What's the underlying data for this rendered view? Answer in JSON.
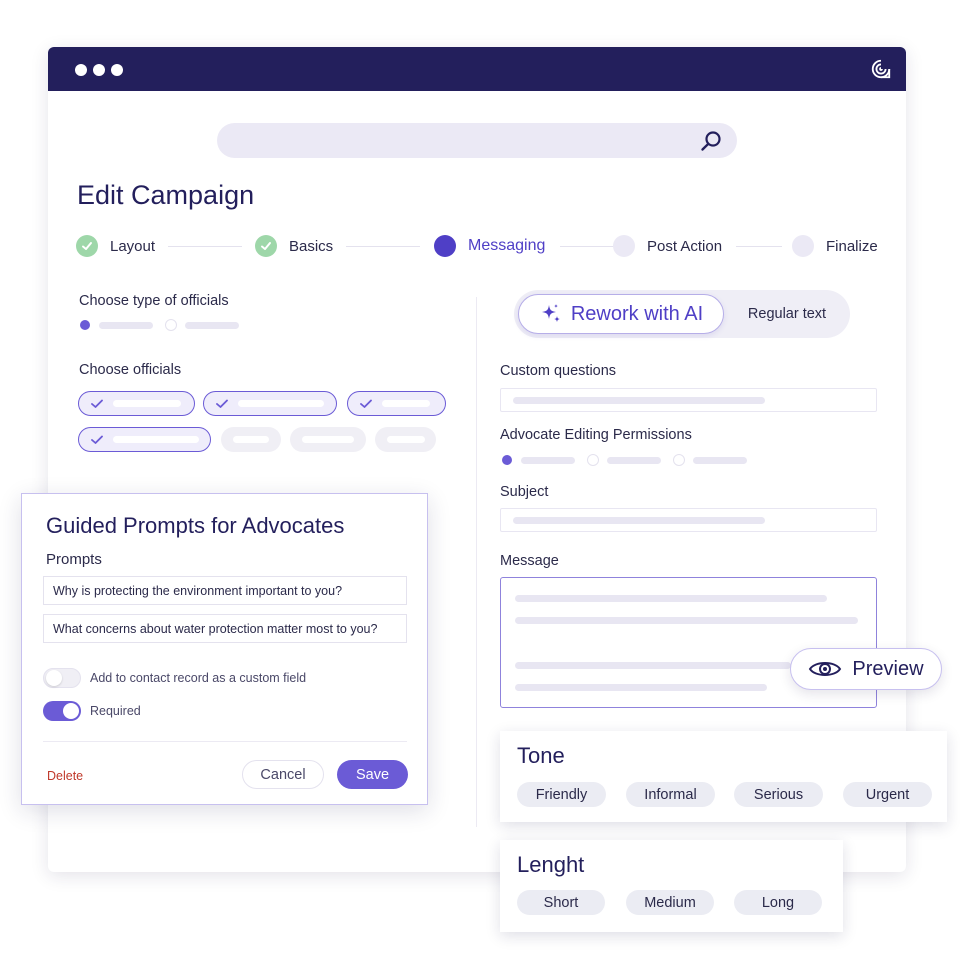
{
  "page": {
    "title": "Edit Campaign"
  },
  "search": {
    "placeholder": ""
  },
  "stepper": {
    "steps": [
      {
        "label": "Layout",
        "state": "done"
      },
      {
        "label": "Basics",
        "state": "done"
      },
      {
        "label": "Messaging",
        "state": "current"
      },
      {
        "label": "Post Action",
        "state": "todo"
      },
      {
        "label": "Finalize",
        "state": "todo"
      }
    ]
  },
  "left": {
    "officials_type_label": "Choose type of officials",
    "officials_label": "Choose officials"
  },
  "mode": {
    "rework": "Rework with AI",
    "regular": "Regular text"
  },
  "right": {
    "custom_questions": "Custom questions",
    "permissions": "Advocate Editing Permissions",
    "subject": "Subject",
    "message": "Message"
  },
  "prompts_panel": {
    "title": "Guided Prompts for Advocates",
    "subtitle": "Prompts",
    "prompts": [
      "Why is protecting the environment important to you?",
      "What concerns about water protection matter most to you?"
    ],
    "custom_field_label": "Add to contact record as a custom field",
    "custom_field_on": false,
    "required_label": "Required",
    "required_on": true,
    "delete": "Delete",
    "cancel": "Cancel",
    "save": "Save"
  },
  "preview": {
    "label": "Preview"
  },
  "tone": {
    "title": "Tone",
    "options": [
      "Friendly",
      "Informal",
      "Serious",
      "Urgent"
    ]
  },
  "length": {
    "title": "Lenght",
    "options": [
      "Short",
      "Medium",
      "Long"
    ]
  },
  "colors": {
    "brand_dark": "#231f5c",
    "accent": "#6b5bd6",
    "done_green": "#9ed7a9"
  }
}
